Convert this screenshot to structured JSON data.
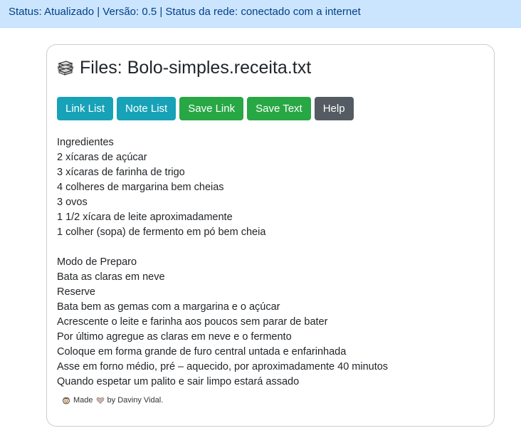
{
  "status_bar": {
    "text": "Status: Atualizado | Versão: 0.5 | Status da rede: conectado com a internet"
  },
  "header": {
    "icon": "books-icon",
    "title_prefix": "Files:",
    "file_name": "Bolo-simples.receita.txt"
  },
  "toolbar": {
    "buttons": [
      {
        "label": "Link List",
        "color": "#17a2b8"
      },
      {
        "label": "Note List",
        "color": "#17a2b8"
      },
      {
        "label": "Save Link",
        "color": "#28a745"
      },
      {
        "label": "Save Text",
        "color": "#28a745"
      },
      {
        "label": "Help",
        "color": "#545b62"
      }
    ]
  },
  "content": {
    "lines": [
      "Ingredientes",
      "2 xícaras de açúcar",
      "3 xícaras de farinha de trigo",
      "4 colheres de margarina bem cheias",
      "3 ovos",
      "1 1/2 xícara de leite aproximadamente",
      "1 colher (sopa) de fermento em pó bem cheia",
      "",
      "Modo de Preparo",
      "Bata as claras em neve",
      "Reserve",
      "Bata bem as gemas com a margarina e o açúcar",
      "Acrescente o leite e farinha aos poucos sem parar de bater",
      "Por último agregue as claras em neve e o fermento",
      "Coloque em forma grande de furo central untada e enfarinhada",
      "Asse em forno médio, pré – aquecido, por aproximadamente 40 minutos",
      "Quando espetar um palito e sair limpo estará assado"
    ]
  },
  "footer": {
    "made": "Made",
    "by": "by Daviny Vidal."
  },
  "colors": {
    "status_bg": "#cce5ff",
    "status_text": "#004085",
    "info": "#17a2b8",
    "success": "#28a745",
    "secondary": "#545b62"
  }
}
